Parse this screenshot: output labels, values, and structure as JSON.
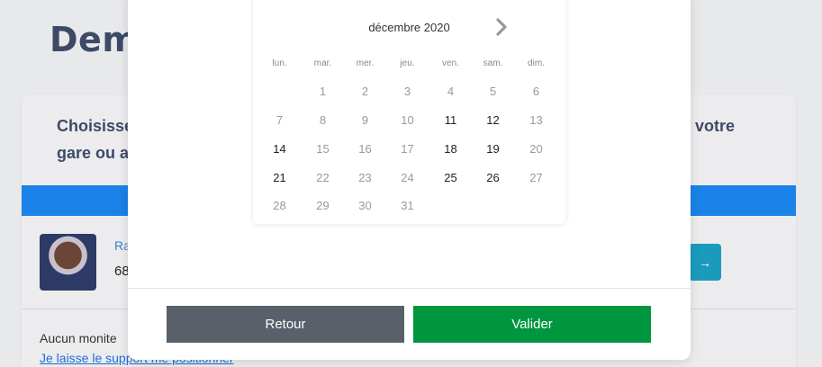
{
  "page": {
    "title": "Dema",
    "card_heading_left": "Choisisse",
    "card_heading_left_line2": "gare ou a",
    "card_heading_right": "votre",
    "person_name": "Ra",
    "person_number": "68",
    "go_arrow": "→",
    "no_monitor_text": "Aucun monite",
    "support_link": "Je laisse le support me positionner"
  },
  "calendar": {
    "month_label": "décembre  2020",
    "weekdays": [
      "lun.",
      "mar.",
      "mer.",
      "jeu.",
      "ven.",
      "sam.",
      "dim."
    ],
    "weeks": [
      [
        "",
        "1",
        "2",
        "3",
        "4",
        "5",
        "6"
      ],
      [
        "7",
        "8",
        "9",
        "10",
        "11",
        "12",
        "13"
      ],
      [
        "14",
        "15",
        "16",
        "17",
        "18",
        "19",
        "20"
      ],
      [
        "21",
        "22",
        "23",
        "24",
        "25",
        "26",
        "27"
      ],
      [
        "28",
        "29",
        "30",
        "31",
        "",
        "",
        ""
      ]
    ],
    "enabled_days": [
      "11",
      "12",
      "14",
      "18",
      "19",
      "21",
      "25",
      "26"
    ]
  },
  "buttons": {
    "back": "Retour",
    "validate": "Valider"
  },
  "colors": {
    "validate": "#009640",
    "back": "#5a6069",
    "band": "#1a82e8"
  }
}
